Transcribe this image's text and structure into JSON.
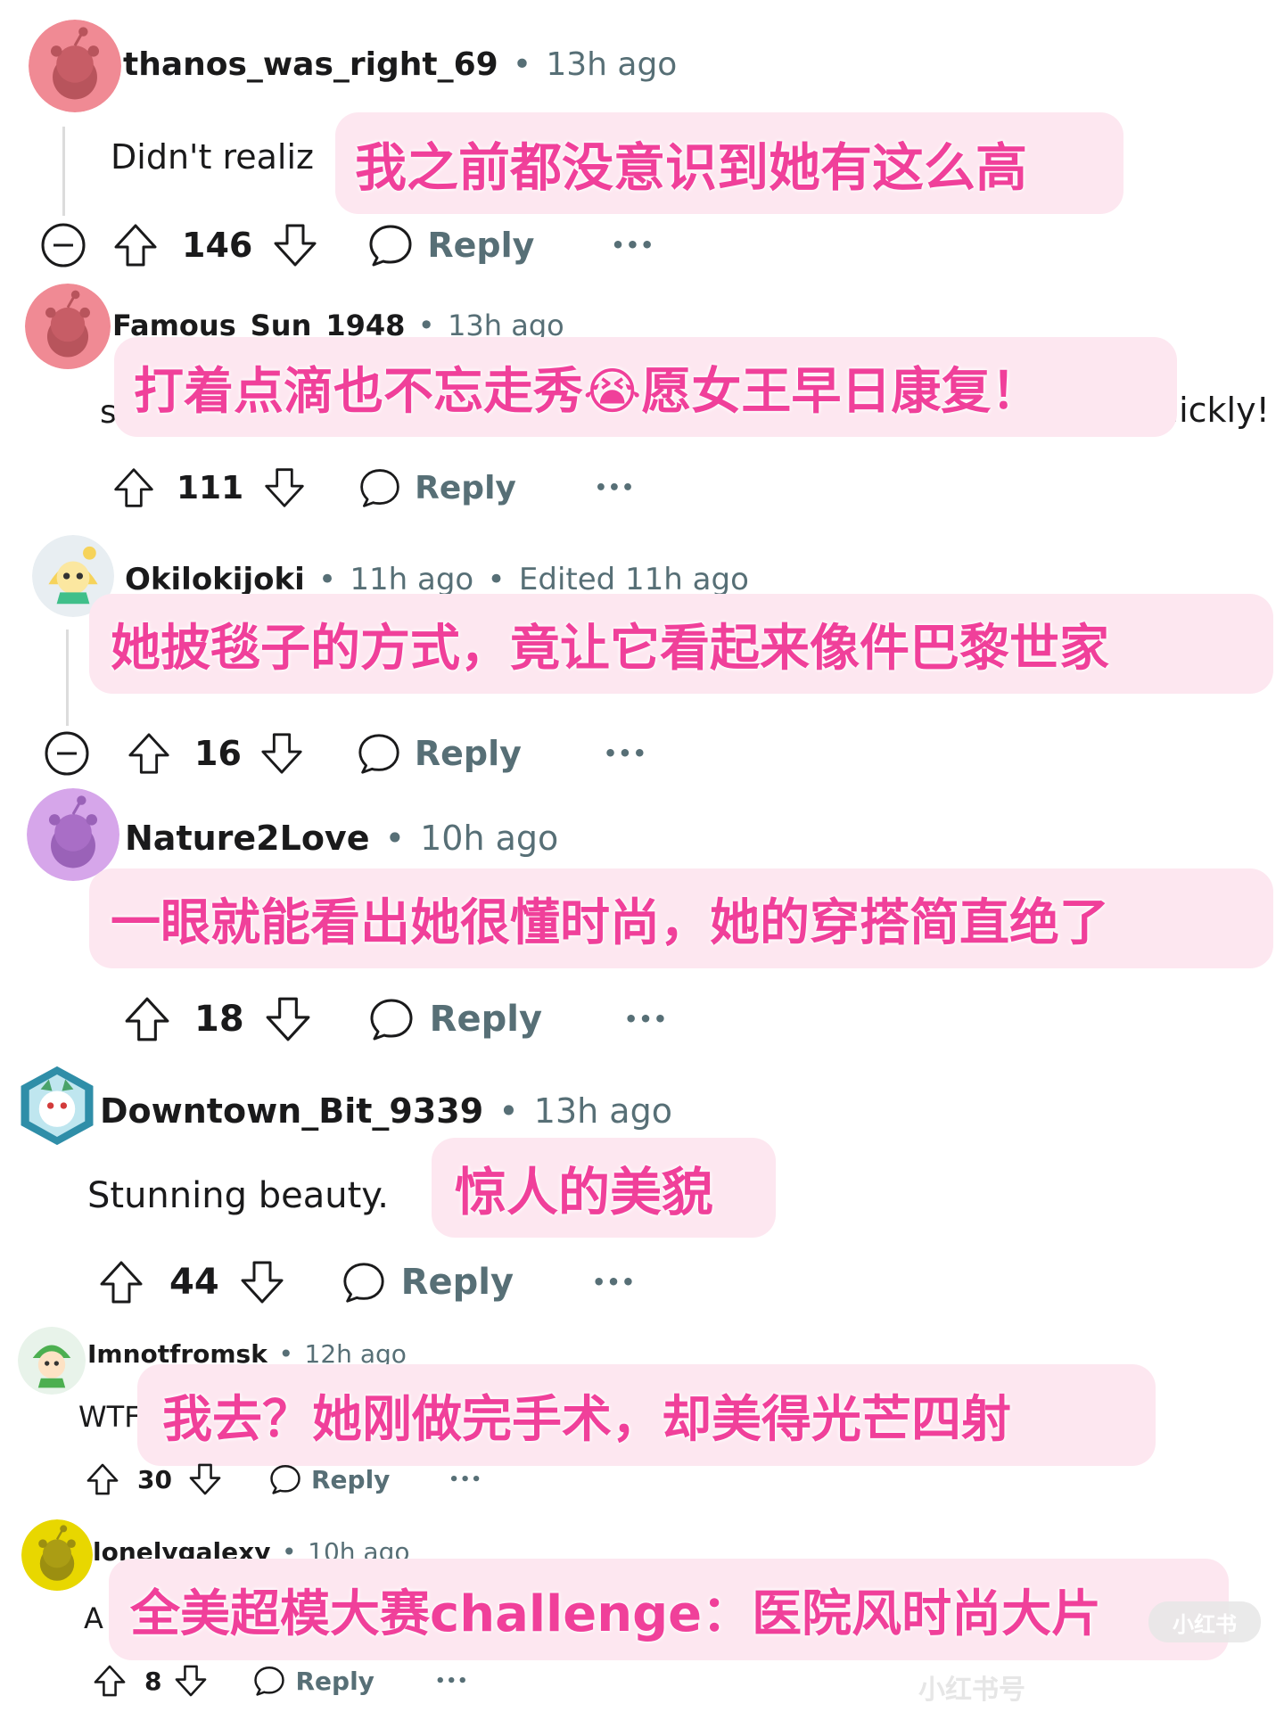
{
  "colors": {
    "overlay_bg": "#fde7f0",
    "overlay_text": "#f0409a",
    "meta_text": "#576f76",
    "thread_line": "#dcdcdc"
  },
  "comments": [
    {
      "username": "thanos_was_right_69",
      "time": "13h ago",
      "body": "Didn't realiz",
      "translation": "我之前都没意识到她有这么高",
      "votes": "146",
      "reply_label": "Reply",
      "more_label": "•••",
      "avatar": "snoo-avatar-pink",
      "collapse_icon": "collapse-minus-icon"
    },
    {
      "username": "Famous_Sun_1948",
      "time": "13h ago",
      "body_left": "s",
      "body_right": "uickly!",
      "translation": "打着点滴也不忘走秀😭愿女王早日康复！",
      "votes": "111",
      "reply_label": "Reply",
      "more_label": "•••",
      "avatar": "snoo-avatar-pink"
    },
    {
      "username": "Okilokijoki",
      "time": "11h ago",
      "edited": "Edited 11h ago",
      "translation": "她披毯子的方式，竟让它看起来像件巴黎世家",
      "votes": "16",
      "reply_label": "Reply",
      "more_label": "•••",
      "avatar": "custom-avatar-cartoon",
      "collapse_icon": "collapse-minus-icon"
    },
    {
      "username": "Nature2Love",
      "time": "10h ago",
      "translation": "一眼就能看出她很懂时尚，她的穿搭简直绝了",
      "votes": "18",
      "reply_label": "Reply",
      "more_label": "•••",
      "avatar": "snoo-avatar-purple"
    },
    {
      "username": "Downtown_Bit_9339",
      "time": "13h ago",
      "body": "Stunning beauty.",
      "translation": "惊人的美貌",
      "votes": "44",
      "reply_label": "Reply",
      "more_label": "•••",
      "avatar": "custom-avatar-dragon"
    },
    {
      "username": "Imnotfromsk",
      "time": "12h ago",
      "body": "WTF",
      "translation": "我去？她刚做完手术，却美得光芒四射",
      "votes": "30",
      "reply_label": "Reply",
      "more_label": "•••",
      "avatar": "custom-avatar-green"
    },
    {
      "username": "lonelygalexy",
      "time": "10h ago",
      "body": "A",
      "translation": "全美超模大赛challenge：医院风时尚大片",
      "votes": "8",
      "reply_label": "Reply",
      "more_label": "•••",
      "avatar": "snoo-avatar-yellow"
    }
  ],
  "watermark": {
    "text": "小红书号",
    "badge": "小红书"
  }
}
